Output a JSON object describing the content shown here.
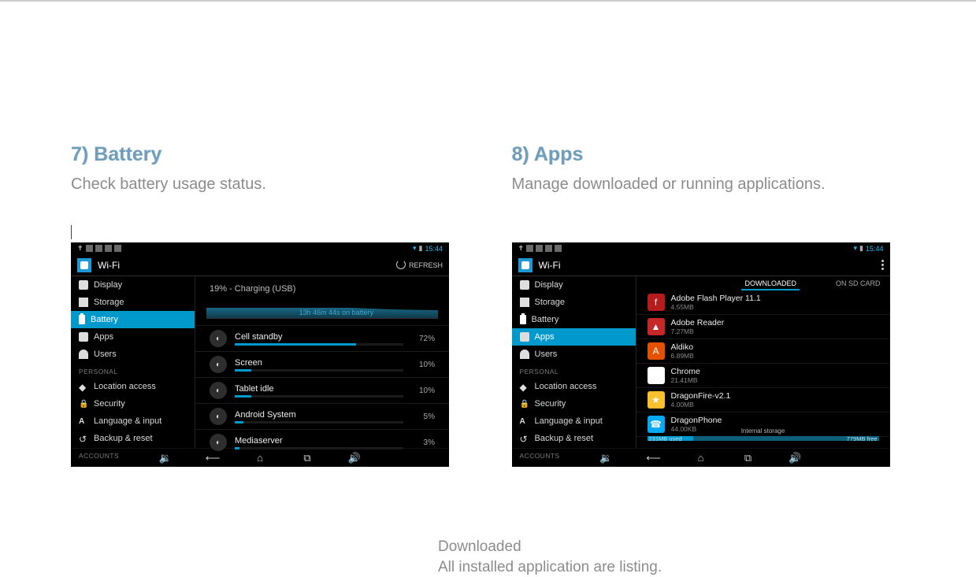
{
  "sections": {
    "battery": {
      "heading": "7) Battery",
      "sub": "Check battery usage status.",
      "statusbar_time": "15:44",
      "actionbar_title": "Wi-Fi",
      "refresh_label": "REFRESH",
      "sidebar": {
        "items": [
          "Display",
          "Storage",
          "Battery",
          "Apps",
          "Users"
        ],
        "selected_index": 2,
        "section_personal": "PERSONAL",
        "personal_items": [
          "Location access",
          "Security",
          "Language & input",
          "Backup & reset"
        ],
        "section_accounts": "ACCOUNTS"
      },
      "charge_line": "19% - Charging (USB)",
      "duration_label": "13h 46m 44s on battery",
      "rows": [
        {
          "name": "Cell standby",
          "pct": "72%",
          "bar": 72
        },
        {
          "name": "Screen",
          "pct": "10%",
          "bar": 10
        },
        {
          "name": "Tablet idle",
          "pct": "10%",
          "bar": 10
        },
        {
          "name": "Android System",
          "pct": "5%",
          "bar": 5
        },
        {
          "name": "Mediaserver",
          "pct": "3%",
          "bar": 3
        }
      ]
    },
    "apps": {
      "heading": "8) Apps",
      "sub": "Manage downloaded or running applications.",
      "statusbar_time": "15:44",
      "actionbar_title": "Wi-Fi",
      "sidebar": {
        "items": [
          "Display",
          "Storage",
          "Battery",
          "Apps",
          "Users"
        ],
        "selected_index": 3,
        "section_personal": "PERSONAL",
        "personal_items": [
          "Location access",
          "Security",
          "Language & input",
          "Backup & reset"
        ],
        "section_accounts": "ACCOUNTS"
      },
      "tabs": {
        "downloaded": "DOWNLOADED",
        "sdcard": "ON SD CARD"
      },
      "apps_list": [
        {
          "name": "Adobe Flash Player 11.1",
          "size": "4.55MB",
          "color": "#b71c1c",
          "glyph": "f"
        },
        {
          "name": "Adobe Reader",
          "size": "7.27MB",
          "color": "#c62828",
          "glyph": "▲"
        },
        {
          "name": "Aldiko",
          "size": "6.89MB",
          "color": "#e65100",
          "glyph": "A"
        },
        {
          "name": "Chrome",
          "size": "21.41MB",
          "color": "#ffffff",
          "glyph": "●"
        },
        {
          "name": "DragonFire-v2.1",
          "size": "4.00MB",
          "color": "#fbc02d",
          "glyph": "★"
        },
        {
          "name": "DragonPhone",
          "size": "44.00KB",
          "color": "#03a9f4",
          "glyph": "☎"
        }
      ],
      "storage_used": "231MB used",
      "storage_free": "779MB free",
      "storage_caption": "Internal storage"
    }
  },
  "bottom": {
    "title": "Downloaded",
    "line": "All installed application are listing."
  }
}
